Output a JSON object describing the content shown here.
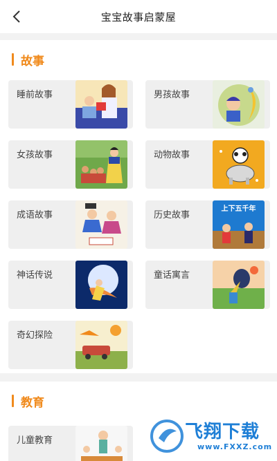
{
  "header": {
    "title": "宝宝故事启蒙屋",
    "back_icon": "chevron-left-icon"
  },
  "sections": [
    {
      "title": "故事",
      "items": [
        {
          "label": "睡前故事"
        },
        {
          "label": "男孩故事"
        },
        {
          "label": "女孩故事"
        },
        {
          "label": "动物故事"
        },
        {
          "label": "成语故事"
        },
        {
          "label": "历史故事"
        },
        {
          "label": "神话传说"
        },
        {
          "label": "童话寓言"
        },
        {
          "label": "奇幻探险"
        }
      ]
    },
    {
      "title": "教育",
      "items": [
        {
          "label": "儿童教育"
        }
      ]
    }
  ],
  "thumb_text": {
    "history": "上下五千年"
  },
  "watermark": {
    "text": "飞翔下载",
    "url": "www.FXXZ.com"
  },
  "colors": {
    "accent": "#f08a1c",
    "card_bg": "#efefef",
    "page_bg": "#f2f2f2",
    "watermark": "#1f7fd6"
  }
}
